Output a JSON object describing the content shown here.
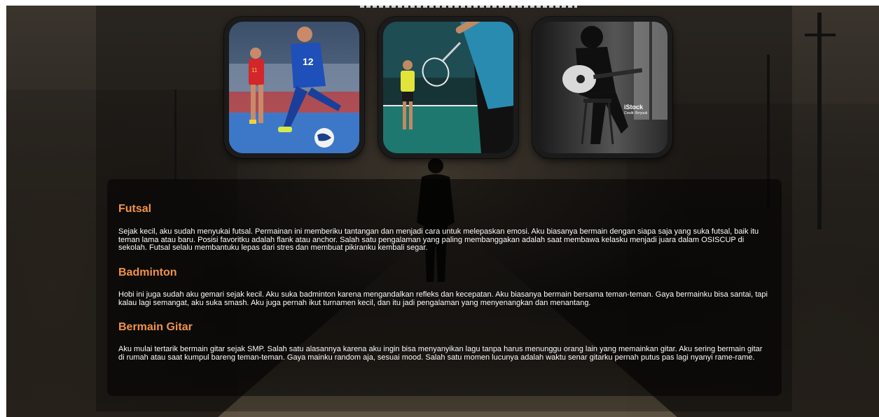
{
  "gallery": [
    {
      "alt": "futsal-photo"
    },
    {
      "alt": "badminton-photo"
    },
    {
      "alt": "guitar-photo",
      "watermark": "iStock",
      "credit": "Credit: Brryouk"
    }
  ],
  "sections": [
    {
      "title": "Futsal",
      "body": "Sejak kecil, aku sudah menyukai futsal. Permainan ini memberiku tantangan dan menjadi cara untuk melepaskan emosi. Aku biasanya bermain dengan siapa saja yang suka futsal, baik itu teman lama atau baru. Posisi favoritku adalah flank atau anchor. Salah satu pengalaman yang paling membanggakan adalah saat membawa kelasku menjadi juara dalam OSISCUP di sekolah. Futsal selalu membantuku lepas dari stres dan membuat pikiranku kembali segar."
    },
    {
      "title": "Badminton",
      "body": "Hobi ini juga sudah aku gemari sejak kecil. Aku suka badminton karena mengandalkan refleks dan kecepatan. Aku biasanya bermain bersama teman-teman. Gaya bermainku bisa santai, tapi kalau lagi semangat, aku suka smash. Aku juga pernah ikut turnamen kecil, dan itu jadi pengalaman yang menyenangkan dan menantang."
    },
    {
      "title": "Bermain Gitar",
      "body": "Aku mulai tertarik bermain gitar sejak SMP. Salah satu alasannya karena aku ingin bisa menyanyikan lagu tanpa harus menunggu orang lain yang memainkan gitar. Aku sering bermain gitar di rumah atau saat kumpul bareng teman-teman. Gaya mainku random aja, sesuai mood. Salah satu momen lucunya adalah waktu senar gitarku pernah putus pas lagi nyanyi rame-rame."
    }
  ],
  "colors": {
    "heading": "#f0924a",
    "text": "#ffffff",
    "panel": "rgba(0,0,0,0.5)"
  }
}
